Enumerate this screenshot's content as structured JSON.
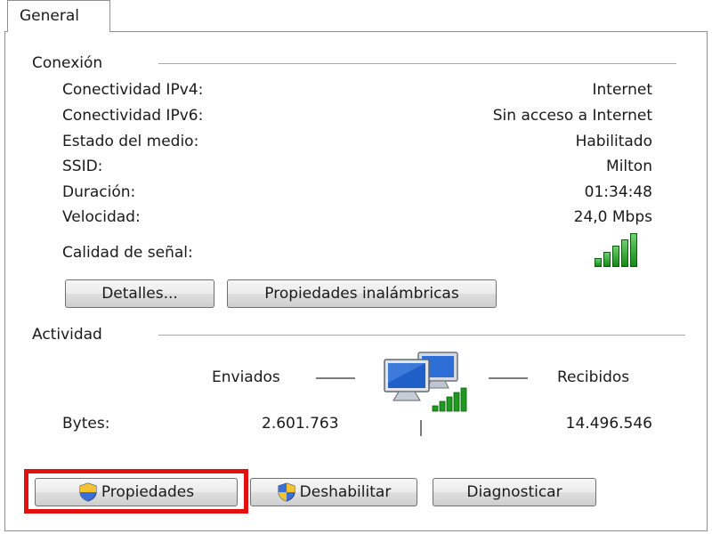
{
  "tab": {
    "label": "General"
  },
  "connection": {
    "title": "Conexión",
    "rows": [
      {
        "label": "Conectividad IPv4:",
        "value": "Internet"
      },
      {
        "label": "Conectividad IPv6:",
        "value": "Sin acceso a Internet"
      },
      {
        "label": "Estado del medio:",
        "value": "Habilitado"
      },
      {
        "label": "SSID:",
        "value": "Milton"
      },
      {
        "label": "Duración:",
        "value": "01:34:48"
      },
      {
        "label": "Velocidad:",
        "value": "24,0 Mbps"
      }
    ],
    "signal_label": "Calidad de señal:",
    "signal_bars_lit": 5,
    "signal_bars_total": 5,
    "details_button": "Detalles...",
    "wireless_props_button": "Propiedades inalámbricas"
  },
  "activity": {
    "title": "Actividad",
    "sent_label": "Enviados",
    "received_label": "Recibidos",
    "bytes_label": "Bytes:",
    "bytes_sent": "2.601.763",
    "bytes_received": "14.496.546"
  },
  "buttons": {
    "properties": "Propiedades",
    "disable": "Deshabilitar",
    "diagnose": "Diagnosticar"
  },
  "colors": {
    "highlight": "#e40f0f",
    "signal_green": "#148a14"
  },
  "icons": {
    "signal": "signal-strength-icon",
    "network": "network-computers-icon",
    "shield": "uac-shield-icon"
  }
}
